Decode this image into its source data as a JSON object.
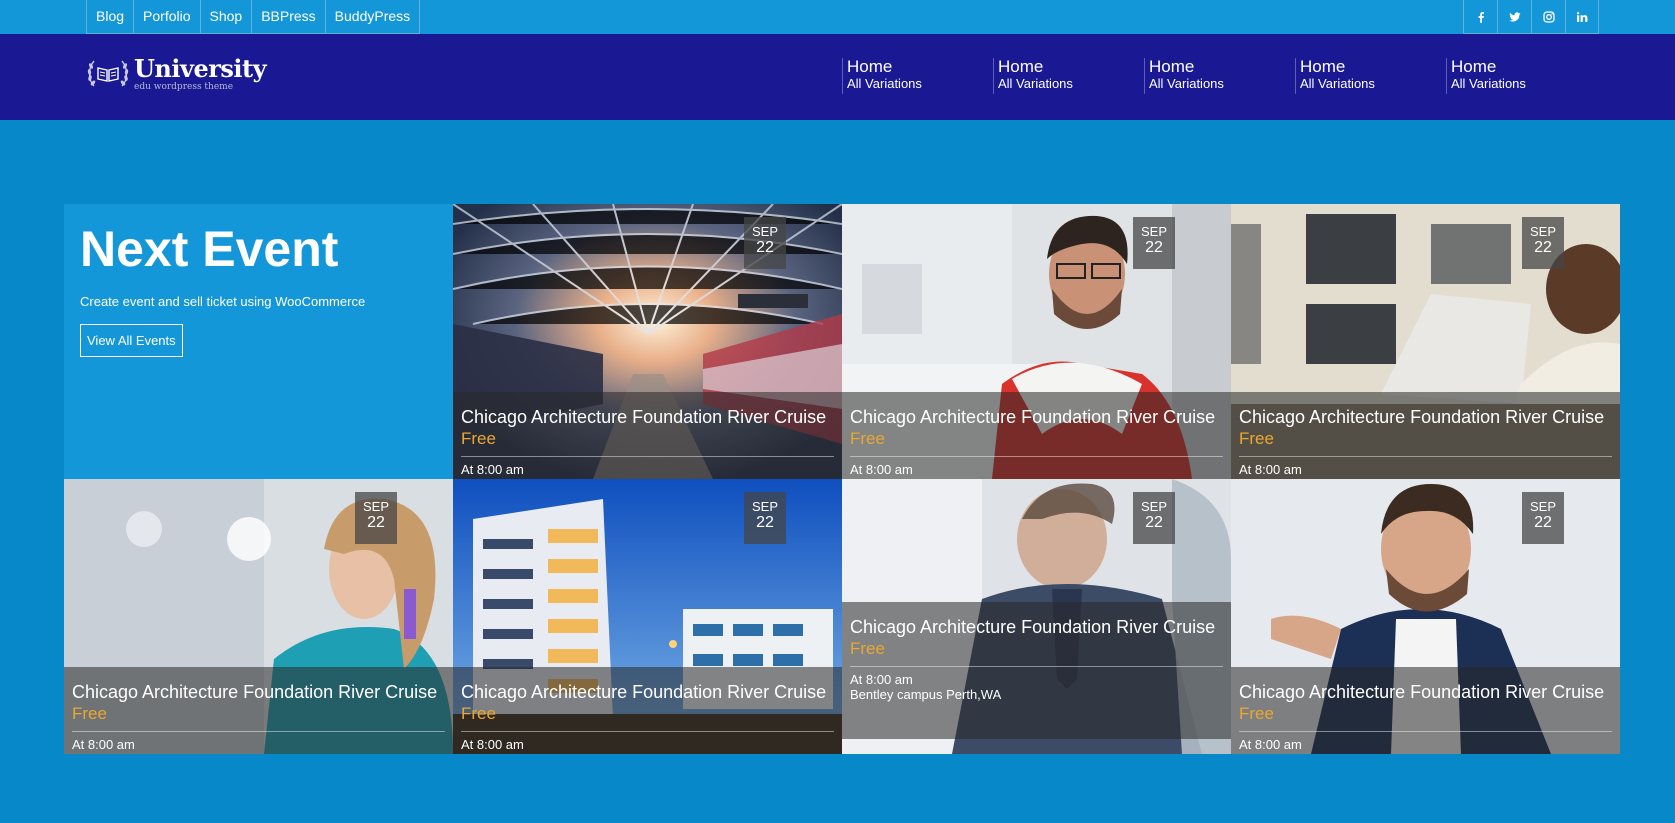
{
  "topbar": {
    "links": [
      "Blog",
      "Porfolio",
      "Shop",
      "BBPress",
      "BuddyPress"
    ],
    "social": [
      {
        "icon": "facebook-icon",
        "glyph": "f"
      },
      {
        "icon": "twitter-icon",
        "glyph": "t"
      },
      {
        "icon": "instagram-icon",
        "glyph": "ig"
      },
      {
        "icon": "linkedin-icon",
        "glyph": "in"
      }
    ]
  },
  "header": {
    "logo_title": "University",
    "logo_subtitle": "edu wordpress theme",
    "nav": [
      {
        "label": "Home",
        "sub": "All Variations"
      },
      {
        "label": "Home",
        "sub": "All Variations"
      },
      {
        "label": "Home",
        "sub": "All Variations"
      },
      {
        "label": "Home",
        "sub": "All Variations"
      },
      {
        "label": "Home",
        "sub": "All Variations"
      }
    ]
  },
  "intro": {
    "title": "Next Event",
    "description": "Create event and sell ticket using WooCommerce",
    "button": "View All Events"
  },
  "events": [
    {
      "month": "SEP",
      "day": "22",
      "title": "Chicago Architecture Foundation River Cruise",
      "price": "Free",
      "time": "At 8:00 am",
      "location": ""
    },
    {
      "month": "SEP",
      "day": "22",
      "title": "Chicago Architecture Foundation River Cruise",
      "price": "Free",
      "time": "At 8:00 am",
      "location": ""
    },
    {
      "month": "SEP",
      "day": "22",
      "title": "Chicago Architecture Foundation River Cruise",
      "price": "Free",
      "time": "At 8:00 am",
      "location": ""
    },
    {
      "month": "SEP",
      "day": "22",
      "title": "Chicago Architecture Foundation River Cruise",
      "price": "Free",
      "time": "At 8:00 am",
      "location": ""
    },
    {
      "month": "SEP",
      "day": "22",
      "title": "Chicago Architecture Foundation River Cruise",
      "price": "Free",
      "time": "At 8:00 am",
      "location": ""
    },
    {
      "month": "SEP",
      "day": "22",
      "title": "Chicago Architecture Foundation River Cruise",
      "price": "Free",
      "time": "At 8:00 am",
      "location": "Bentley campus Perth,WA"
    },
    {
      "month": "SEP",
      "day": "22",
      "title": "Chicago Architecture Foundation River Cruise",
      "price": "Free",
      "time": "At 8:00 am",
      "location": ""
    }
  ],
  "colors": {
    "page_bg": "#0788c9",
    "topbar_bg": "#1497d8",
    "header_bg": "#1a1993",
    "price": "#e9a830"
  }
}
